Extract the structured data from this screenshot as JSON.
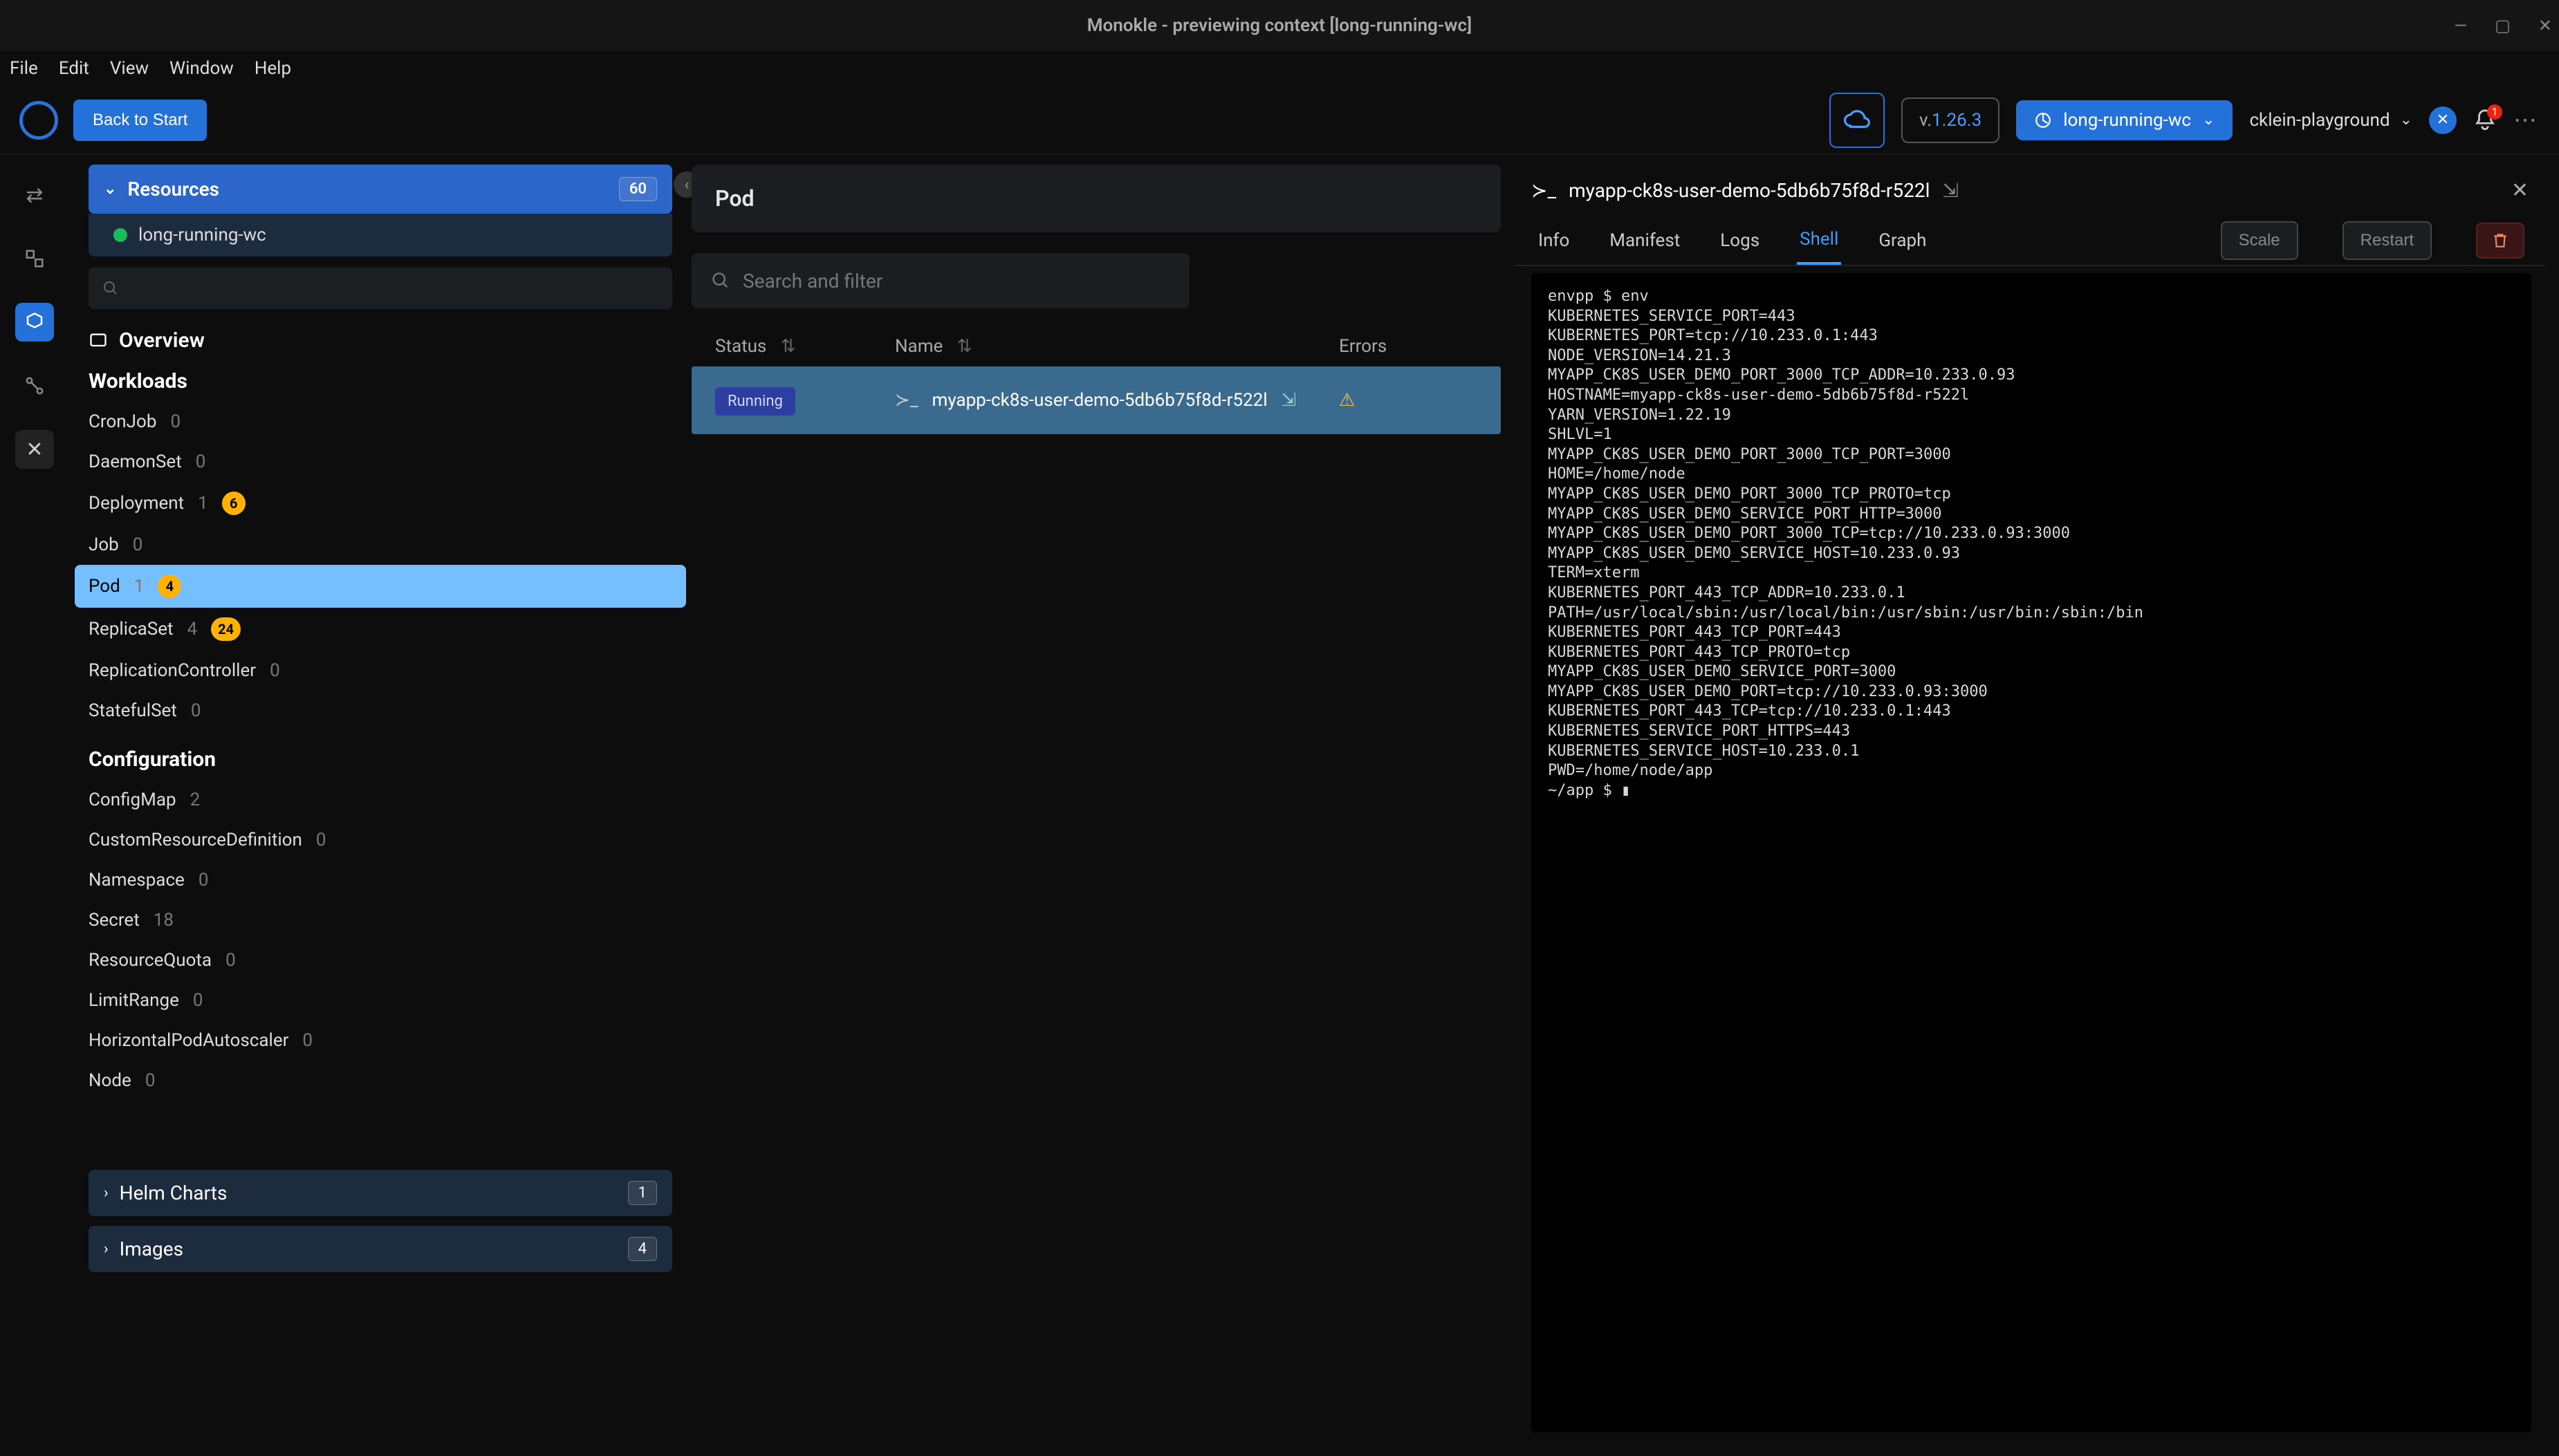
{
  "window": {
    "title": "Monokle - previewing context [long-running-wc]"
  },
  "menubar": [
    "File",
    "Edit",
    "View",
    "Window",
    "Help"
  ],
  "toolbar": {
    "back_label": "Back to Start",
    "version_prefix": "v.",
    "version": "1.26.3",
    "cluster": "long-running-wc",
    "project": "cklein-playground",
    "notif_count": "1"
  },
  "sidebar": {
    "resources": {
      "title": "Resources",
      "count": "60",
      "context": "long-running-wc"
    },
    "overview_label": "Overview",
    "sections": {
      "workloads": {
        "title": "Workloads",
        "items": [
          {
            "name": "CronJob",
            "count": "0"
          },
          {
            "name": "DaemonSet",
            "count": "0"
          },
          {
            "name": "Deployment",
            "count": "1",
            "badge": "6"
          },
          {
            "name": "Job",
            "count": "0"
          },
          {
            "name": "Pod",
            "count": "1",
            "badge": "4",
            "selected": true
          },
          {
            "name": "ReplicaSet",
            "count": "4",
            "badge": "24"
          },
          {
            "name": "ReplicationController",
            "count": "0"
          },
          {
            "name": "StatefulSet",
            "count": "0"
          }
        ]
      },
      "configuration": {
        "title": "Configuration",
        "items": [
          {
            "name": "ConfigMap",
            "count": "2"
          },
          {
            "name": "CustomResourceDefinition",
            "count": "0"
          },
          {
            "name": "Namespace",
            "count": "0"
          },
          {
            "name": "Secret",
            "count": "18"
          },
          {
            "name": "ResourceQuota",
            "count": "0"
          },
          {
            "name": "LimitRange",
            "count": "0"
          },
          {
            "name": "HorizontalPodAutoscaler",
            "count": "0"
          },
          {
            "name": "Node",
            "count": "0"
          }
        ]
      }
    },
    "footers": [
      {
        "label": "Helm Charts",
        "count": "1"
      },
      {
        "label": "Images",
        "count": "4"
      }
    ]
  },
  "center": {
    "breadcrumb": "Pod",
    "filter_placeholder": "Search and filter",
    "columns": {
      "status": "Status",
      "name": "Name",
      "errors": "Errors"
    },
    "row": {
      "status": "Running",
      "name": "myapp-ck8s-user-demo-5db6b75f8d-r522l",
      "errors_glyph": "⚠"
    }
  },
  "detail": {
    "title": "myapp-ck8s-user-demo-5db6b75f8d-r522l",
    "tabs": [
      "Info",
      "Manifest",
      "Logs",
      "Shell",
      "Graph"
    ],
    "active_tab": "Shell",
    "buttons": {
      "scale": "Scale",
      "restart": "Restart"
    },
    "terminal": "envpp $ env\nKUBERNETES_SERVICE_PORT=443\nKUBERNETES_PORT=tcp://10.233.0.1:443\nNODE_VERSION=14.21.3\nMYAPP_CK8S_USER_DEMO_PORT_3000_TCP_ADDR=10.233.0.93\nHOSTNAME=myapp-ck8s-user-demo-5db6b75f8d-r522l\nYARN_VERSION=1.22.19\nSHLVL=1\nMYAPP_CK8S_USER_DEMO_PORT_3000_TCP_PORT=3000\nHOME=/home/node\nMYAPP_CK8S_USER_DEMO_PORT_3000_TCP_PROTO=tcp\nMYAPP_CK8S_USER_DEMO_SERVICE_PORT_HTTP=3000\nMYAPP_CK8S_USER_DEMO_PORT_3000_TCP=tcp://10.233.0.93:3000\nMYAPP_CK8S_USER_DEMO_SERVICE_HOST=10.233.0.93\nTERM=xterm\nKUBERNETES_PORT_443_TCP_ADDR=10.233.0.1\nPATH=/usr/local/sbin:/usr/local/bin:/usr/sbin:/usr/bin:/sbin:/bin\nKUBERNETES_PORT_443_TCP_PORT=443\nKUBERNETES_PORT_443_TCP_PROTO=tcp\nMYAPP_CK8S_USER_DEMO_SERVICE_PORT=3000\nMYAPP_CK8S_USER_DEMO_PORT=tcp://10.233.0.93:3000\nKUBERNETES_PORT_443_TCP=tcp://10.233.0.1:443\nKUBERNETES_SERVICE_PORT_HTTPS=443\nKUBERNETES_SERVICE_HOST=10.233.0.1\nPWD=/home/node/app\n~/app $ ▮"
  }
}
